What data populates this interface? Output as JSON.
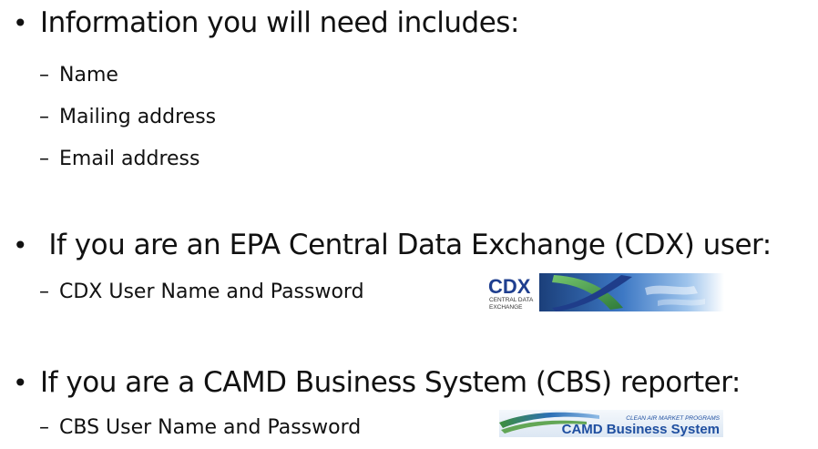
{
  "bullets": [
    {
      "text": "Information you will need includes:",
      "subitems": [
        "Name",
        "Mailing address",
        "Email address"
      ]
    },
    {
      "text": " If you are an EPA Central Data Exchange (CDX) user:",
      "subitems": [
        "CDX User Name and Password"
      ],
      "logo": {
        "name": "cdx-logo",
        "text_main": "CDX",
        "text_sub1": "CENTRAL DATA",
        "text_sub2": "EXCHANGE"
      }
    },
    {
      "text": "If you are a CAMD Business System (CBS) reporter:",
      "subitems": [
        "CBS User Name and Password"
      ],
      "logo": {
        "name": "camd-logo",
        "text_top": "CLEAN AIR MARKET PROGRAMS",
        "text_main": "CAMD Business System"
      }
    }
  ],
  "symbols": {
    "bullet": "•",
    "dash": "–"
  },
  "colors": {
    "text": "#111111",
    "cdx_blue": "#1d3f8f",
    "cdx_green": "#3f8f35",
    "camd_blue": "#1f4fa0",
    "camd_green": "#4b9a3a"
  }
}
